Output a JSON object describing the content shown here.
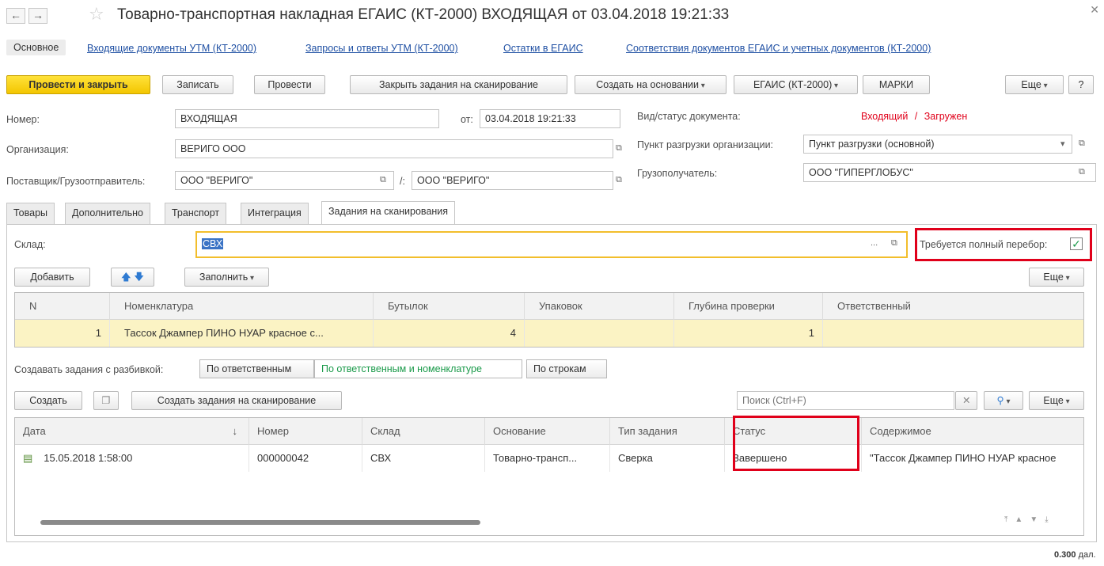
{
  "window": {
    "title": "Товарно-транспортная накладная ЕГАИС (КТ-2000) ВХОДЯЩАЯ от 03.04.2018 19:21:33",
    "back_icon": "arrow-left",
    "forward_icon": "arrow-right",
    "star_icon": "star",
    "close_icon": "close"
  },
  "nav": {
    "links": [
      "Основное",
      "Входящие документы УТМ (КТ-2000)",
      "Запросы и ответы УТМ (КТ-2000)",
      "Остатки в ЕГАИС",
      "Соответствия документов ЕГАИС и учетных документов (КТ-2000)"
    ]
  },
  "toolbar": {
    "post_close": "Провести и закрыть",
    "save": "Записать",
    "post": "Провести",
    "close_tasks": "Закрыть задания на сканирование",
    "create_based": "Создать на основании",
    "egais": "ЕГАИС (КТ-2000)",
    "marks": "МАРКИ",
    "more": "Еще",
    "help": "?"
  },
  "header": {
    "number_label": "Номер:",
    "number_value": "ВХОДЯЩАЯ",
    "date_label": "от:",
    "date_value": "03.04.2018 19:21:33",
    "doc_status_label": "Вид/статус документа:",
    "doc_kind": "Входящий",
    "doc_sep": "/",
    "doc_status": "Загружен",
    "org_label": "Организация:",
    "org_value": "ВЕРИГО ООО",
    "unload_label": "Пункт разгрузки организации:",
    "unload_value": "Пункт разгрузки (основной)",
    "supplier_label": "Поставщик/Грузоотправитель:",
    "supplier_value": "ООО \"ВЕРИГО\"",
    "shipper_sep": "/:",
    "shipper_value": "ООО \"ВЕРИГО\"",
    "consignee_label": "Грузополучатель:",
    "consignee_value": "ООО \"ГИПЕРГЛОБУС\""
  },
  "tabs": [
    "Товары",
    "Дополнительно",
    "Транспорт",
    "Интеграция",
    "Задания на сканирования"
  ],
  "scan": {
    "warehouse_label": "Склад:",
    "warehouse_value": "СВХ",
    "full_check_label": "Требуется полный перебор:",
    "full_check_checked": true,
    "add": "Добавить",
    "fill": "Заполнить",
    "more": "Еще",
    "columns": [
      "N",
      "Номенклатура",
      "Бутылок",
      "Упаковок",
      "Глубина проверки",
      "Ответственный"
    ],
    "rows": [
      {
        "n": "1",
        "item": "Тассок Джампер ПИНО НУАР красное с...",
        "bottles": "4",
        "packs": "",
        "depth": "1",
        "resp": ""
      }
    ],
    "split_label": "Создавать задания с разбивкой:",
    "split_options": [
      "По ответственным",
      "По ответственным и номенклатуре",
      "По строкам"
    ],
    "split_selected": 1
  },
  "tasks": {
    "create": "Создать",
    "create_tasks": "Создать задания на сканирование",
    "search_placeholder": "Поиск (Ctrl+F)",
    "search_icon": "magnifier",
    "more": "Еще",
    "columns": [
      "Дата",
      "Номер",
      "Склад",
      "Основание",
      "Тип задания",
      "Статус",
      "Содержимое"
    ],
    "sort_arrow": "↓",
    "rows": [
      {
        "date": "15.05.2018 1:58:00",
        "number": "000000042",
        "warehouse": "СВХ",
        "basis": "Товарно-трансп...",
        "type": "Сверка",
        "status": "Завершено",
        "content": "\"Тассок Джампер ПИНО НУАР красное"
      }
    ]
  },
  "footer": {
    "volume": "0.300",
    "unit": "дал."
  },
  "colors": {
    "accent": "#f3c600",
    "status_red": "#e0001a",
    "link": "#1e4fa3",
    "selected_row": "#fbf3c4"
  }
}
